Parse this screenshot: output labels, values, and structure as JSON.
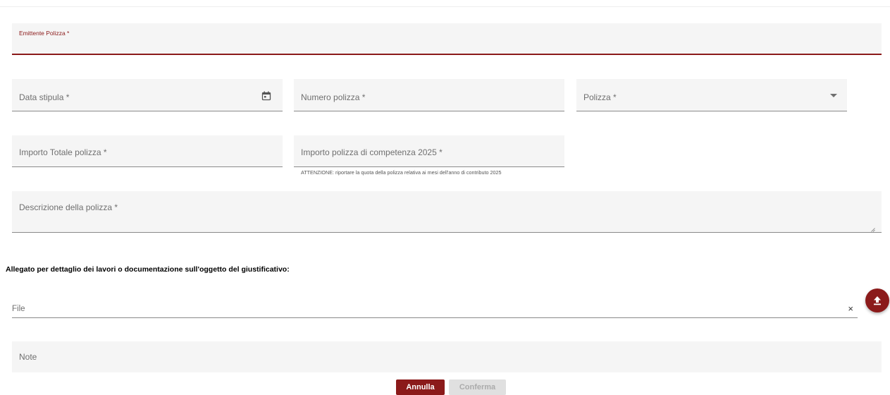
{
  "form": {
    "emittente_label": "Emittente Polizza *",
    "data_stipula_label": "Data stipula *",
    "numero_polizza_label": "Numero polizza *",
    "polizza_label": "Polizza *",
    "importo_totale_label": "Importo Totale polizza *",
    "importo_competenza_label": "Importo polizza di competenza 2025 *",
    "importo_competenza_hint": "ATTENZIONE: riportare la quota della polizza relativa ai mesi dell'anno di contributo 2025",
    "descrizione_label": "Descrizione della polizza *",
    "note_label": "Note"
  },
  "attachment": {
    "section_title": "Allegato per dettaglio dei lavori o documentazione sull'oggetto del giustificativo:",
    "file_label": "File",
    "clear_glyph": "×"
  },
  "actions": {
    "cancel_label": "Annulla",
    "confirm_label": "Conferma"
  },
  "icons": {
    "date": "calendar-icon",
    "select": "chevron-down-icon",
    "clear": "close-icon",
    "upload": "upload-icon"
  },
  "colors": {
    "accent": "#8b1a1a",
    "field_background": "#f5f5f5",
    "disabled_button": "#e0e0e0"
  }
}
